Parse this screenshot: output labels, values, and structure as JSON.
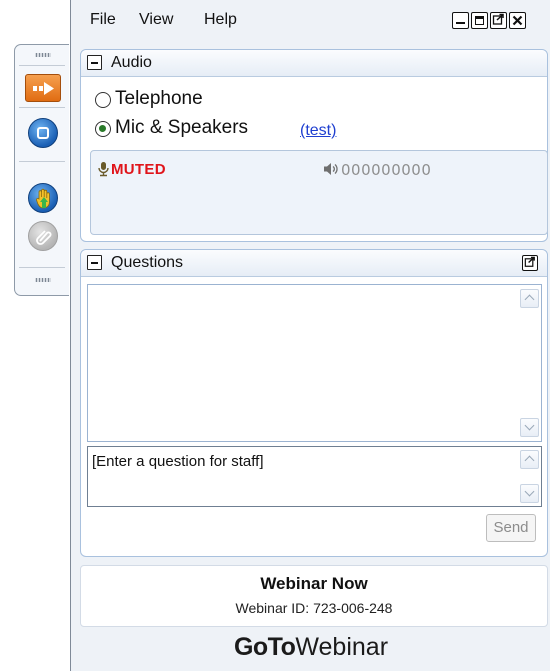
{
  "menu": {
    "file": "File",
    "view": "View",
    "help": "Help"
  },
  "audio": {
    "title": "Audio",
    "option_telephone": "Telephone",
    "option_mic": "Mic & Speakers",
    "selected": "Mic & Speakers",
    "test_link": "(test)",
    "mic_status": "MUTED",
    "level_meter": "000000000",
    "status_color": "#e0141a"
  },
  "questions": {
    "title": "Questions",
    "input_placeholder": "[Enter a question for staff]",
    "send_label": "Send"
  },
  "footer": {
    "webinar_title": "Webinar Now",
    "webinar_id": "Webinar ID: 723-006-248",
    "brand_bold": "GoTo",
    "brand_light": "Webinar"
  },
  "icons": {
    "grab_tab": [
      "arrow-right-icon",
      "stop-icon",
      "raise-hand-icon",
      "pin-icon"
    ],
    "window": [
      "minimize-icon",
      "restore-icon",
      "popout-icon",
      "close-icon"
    ]
  },
  "colors": {
    "accent_orange": "#f08a2c",
    "accent_blue": "#1a5fb4",
    "link_blue": "#1f3fd0"
  }
}
